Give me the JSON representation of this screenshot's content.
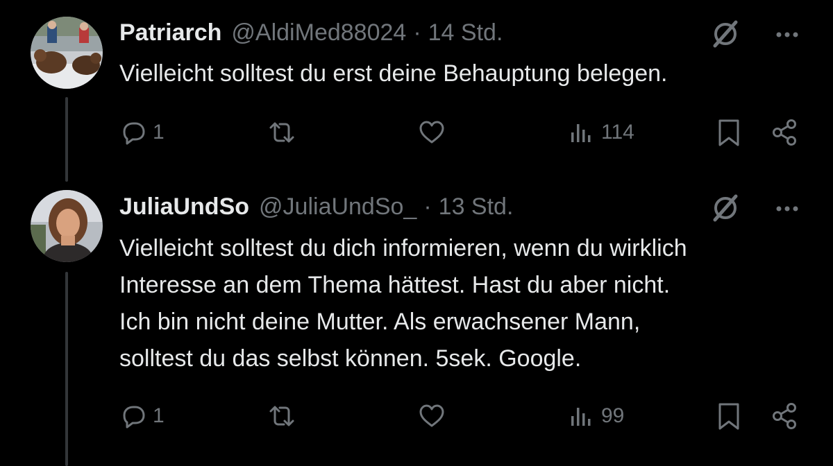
{
  "tweets": [
    {
      "author": {
        "name": "Patriarch",
        "handle": "@AldiMed88024",
        "avatar": "bears-sled-photo"
      },
      "separator": "·",
      "time": "14 Std.",
      "text_lines": [
        "Vielleicht solltest du erst deine Behauptung belegen."
      ],
      "stats": {
        "replies": "1",
        "retweets": "",
        "likes": "",
        "views": "114"
      }
    },
    {
      "author": {
        "name": "JuliaUndSo",
        "handle": "@JuliaUndSo_",
        "avatar": "woman-portrait-photo"
      },
      "separator": "·",
      "time": "13 Std.",
      "text_lines": [
        "Vielleicht solltest du dich informieren, wenn du wirklich",
        "Interesse an dem Thema hättest. Hast du aber nicht.",
        "Ich bin nicht deine Mutter. Als erwachsener Mann,",
        "solltest du das selbst können. 5sek. Google."
      ],
      "stats": {
        "replies": "1",
        "retweets": "",
        "likes": "",
        "views": "99"
      }
    }
  ],
  "icons": {
    "reply": "reply-icon",
    "retweet": "retweet-icon",
    "like": "like-icon",
    "views": "views-icon",
    "bookmark": "bookmark-icon",
    "share": "share-icon",
    "grok": "grok-icon",
    "more": "more-icon"
  },
  "colors": {
    "background": "#000000",
    "text_primary": "#e7e9ea",
    "text_secondary": "#71767b",
    "thread_line": "#333639"
  }
}
